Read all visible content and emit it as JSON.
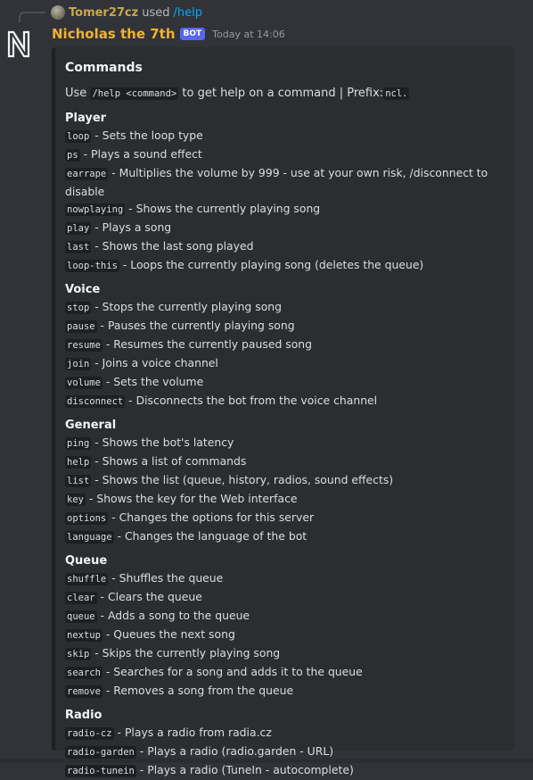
{
  "reply": {
    "username": "Tomer27cz",
    "used_text": "used",
    "command": "/help"
  },
  "message": {
    "author": "Nicholas the 7th",
    "bot_tag": "BOT",
    "timestamp": "Today at 14:06"
  },
  "embed": {
    "title": "Commands",
    "description": {
      "prefix_text": "Use",
      "help_code": "/help <command>",
      "middle_text": "to get help on a command | Prefix:",
      "prefix_code": "ncl."
    },
    "sections": [
      {
        "name": "Player",
        "commands": [
          {
            "cmd": "loop",
            "desc": "Sets the loop type"
          },
          {
            "cmd": "ps",
            "desc": "Plays a sound effect"
          },
          {
            "cmd": "earrape",
            "desc": "Multiplies the volume by 999 - use at your own risk, /disconnect to disable"
          },
          {
            "cmd": "nowplaying",
            "desc": "Shows the currently playing song"
          },
          {
            "cmd": "play",
            "desc": "Plays a song"
          },
          {
            "cmd": "last",
            "desc": "Shows the last song played"
          },
          {
            "cmd": "loop-this",
            "desc": "Loops the currently playing song (deletes the queue)"
          }
        ]
      },
      {
        "name": "Voice",
        "commands": [
          {
            "cmd": "stop",
            "desc": "Stops the currently playing song"
          },
          {
            "cmd": "pause",
            "desc": "Pauses the currently playing song"
          },
          {
            "cmd": "resume",
            "desc": "Resumes the currently paused song"
          },
          {
            "cmd": "join",
            "desc": "Joins a voice channel"
          },
          {
            "cmd": "volume",
            "desc": "Sets the volume"
          },
          {
            "cmd": "disconnect",
            "desc": "Disconnects the bot from the voice channel"
          }
        ]
      },
      {
        "name": "General",
        "commands": [
          {
            "cmd": "ping",
            "desc": "Shows the bot's latency"
          },
          {
            "cmd": "help",
            "desc": "Shows a list of commands"
          },
          {
            "cmd": "list",
            "desc": "Shows the list (queue, history, radios, sound effects)"
          },
          {
            "cmd": "key",
            "desc": "Shows the key for the Web interface"
          },
          {
            "cmd": "options",
            "desc": "Changes the options for this server"
          },
          {
            "cmd": "language",
            "desc": "Changes the language of the bot"
          }
        ]
      },
      {
        "name": "Queue",
        "commands": [
          {
            "cmd": "shuffle",
            "desc": "Shuffles the queue"
          },
          {
            "cmd": "clear",
            "desc": "Clears the queue"
          },
          {
            "cmd": "queue",
            "desc": "Adds a song to the queue"
          },
          {
            "cmd": "nextup",
            "desc": "Queues the next song"
          },
          {
            "cmd": "skip",
            "desc": "Skips the currently playing song"
          },
          {
            "cmd": "search",
            "desc": "Searches for a song and adds it to the queue"
          },
          {
            "cmd": "remove",
            "desc": "Removes a song from the queue"
          }
        ]
      },
      {
        "name": "Radio",
        "commands": [
          {
            "cmd": "radio-cz",
            "desc": "Plays a radio from radia.cz"
          },
          {
            "cmd": "radio-garden",
            "desc": "Plays a radio (radio.garden - URL)"
          },
          {
            "cmd": "radio-tunein",
            "desc": "Plays a radio (TuneIn - autocomplete)"
          }
        ]
      }
    ]
  },
  "separator": " - ",
  "colors": {
    "background": "#313338",
    "embed_background": "#2b2d31",
    "username": "#f0b232",
    "reply_username": "#c9a94d",
    "link": "#00a8fc",
    "bot_tag": "#5865f2"
  }
}
